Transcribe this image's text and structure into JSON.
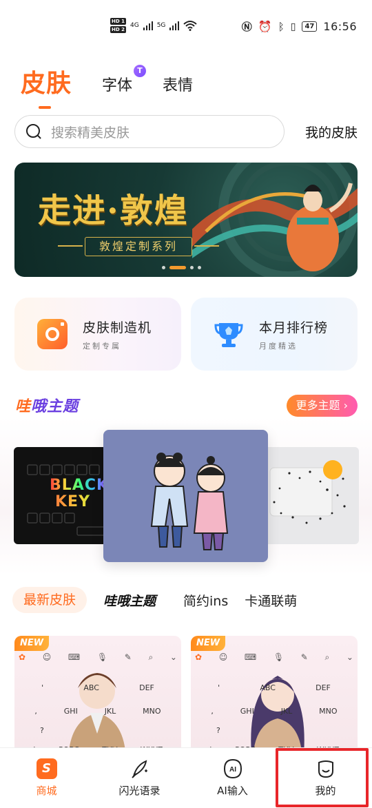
{
  "status_bar": {
    "hd1": "HD 1",
    "hd2": "HD 2",
    "net1": "4G",
    "net2": "5G",
    "battery": "47",
    "time": "16:56"
  },
  "top_tabs": {
    "active": "皮肤",
    "fonts": "字体",
    "fonts_badge": "T",
    "emoji": "表情"
  },
  "search": {
    "placeholder": "搜索精美皮肤",
    "my_skin": "我的皮肤"
  },
  "banner": {
    "title": "走进·敦煌",
    "subtitle": "敦煌定制系列",
    "dots": 4,
    "active_dot": 1
  },
  "features": [
    {
      "title": "皮肤制造机",
      "subtitle": "定制专属"
    },
    {
      "title": "本月排行榜",
      "subtitle": "月度精选"
    }
  ],
  "theme_section": {
    "logo_prefix": "哇",
    "logo_rest": "哦主题",
    "more": "更多主题 ›",
    "black_key_1": "BLACK",
    "black_key_2": "KEY"
  },
  "categories": {
    "active": "最新皮肤",
    "wae": "哇哦主题",
    "simple": "简约ins",
    "cartoon": "卡通联萌"
  },
  "skins": [
    {
      "badge": "NEW",
      "rows": [
        [
          "'",
          "ABC",
          "DEF"
        ],
        [
          ",",
          "GHI",
          "JKL",
          "MNO"
        ],
        [
          "?",
          "",
          "",
          ""
        ],
        [
          "!",
          "PQRS",
          "TUV",
          "WXYZ"
        ]
      ]
    },
    {
      "badge": "NEW",
      "rows": [
        [
          "'",
          "ABC",
          "DEF"
        ],
        [
          ",",
          "GHI",
          "JKL",
          "MNO"
        ],
        [
          "?",
          "",
          "",
          ""
        ],
        [
          "!",
          "PQRS",
          "TUV",
          "WXYZ"
        ]
      ]
    }
  ],
  "bottom_nav": [
    {
      "label": "商城",
      "active": true,
      "icon": "shop-icon"
    },
    {
      "label": "闪光语录",
      "active": false,
      "icon": "quill-icon"
    },
    {
      "label": "AI输入",
      "active": false,
      "icon": "ai-icon"
    },
    {
      "label": "我的",
      "active": false,
      "icon": "profile-face-icon"
    }
  ],
  "colors": {
    "accent": "#ff6b1f",
    "highlight": "#e8262a"
  }
}
